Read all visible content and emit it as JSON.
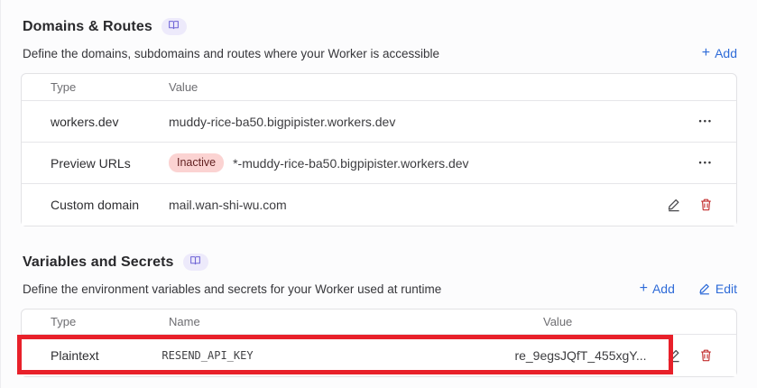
{
  "icons": {
    "more_options": "•••",
    "plus": "+"
  },
  "colors": {
    "accent_blue": "#2e6bd8",
    "badge_inactive_bg": "#fbd3d2",
    "badge_inactive_text": "#601f1f",
    "danger_red": "#c22f2f",
    "doc_badge_purple": "#7066d6",
    "annotation_red": "#e8202a"
  },
  "domains_section": {
    "title": "Domains & Routes",
    "subtitle": "Define the domains, subdomains and routes where your Worker is accessible",
    "add_label": "Add",
    "table": {
      "columns": {
        "type": "Type",
        "value": "Value"
      },
      "rows": [
        {
          "type": "workers.dev",
          "value": "muddy-rice-ba50.bigpipister.workers.dev"
        },
        {
          "type": "Preview URLs",
          "badge": "Inactive",
          "value": "*-muddy-rice-ba50.bigpipister.workers.dev"
        },
        {
          "type": "Custom domain",
          "value": "mail.wan-shi-wu.com"
        }
      ]
    }
  },
  "variables_section": {
    "title": "Variables and Secrets",
    "subtitle": "Define the environment variables and secrets for your Worker used at runtime",
    "add_label": "Add",
    "edit_label": "Edit",
    "table": {
      "columns": {
        "type": "Type",
        "name": "Name",
        "value": "Value"
      },
      "rows": [
        {
          "type": "Plaintext",
          "name": "RESEND_API_KEY",
          "value": "re_9egsJQfT_455xgY..."
        }
      ]
    }
  }
}
